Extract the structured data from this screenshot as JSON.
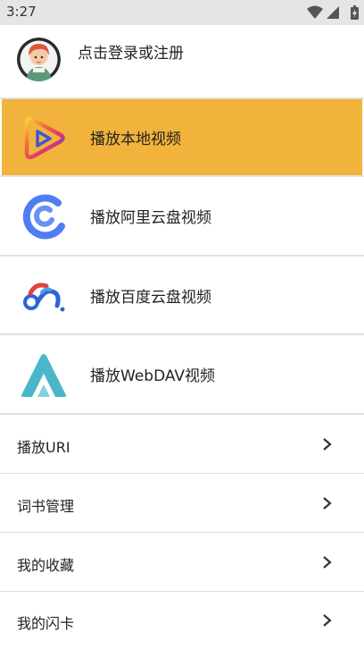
{
  "status_bar": {
    "time": "3:27"
  },
  "header": {
    "login_label": "点击登录或注册"
  },
  "tiles": [
    {
      "label": "播放本地视频",
      "icon": "play-triangle-icon"
    },
    {
      "label": "播放阿里云盘视频",
      "icon": "aliyun-drive-icon"
    },
    {
      "label": "播放百度云盘视频",
      "icon": "baidu-cloud-icon"
    },
    {
      "label": "播放WebDAV视频",
      "icon": "webdav-icon"
    }
  ],
  "rows": [
    {
      "label": "播放URI",
      "icon": "chevron-right-icon"
    },
    {
      "label": "词书管理",
      "icon": "chevron-right-icon"
    },
    {
      "label": "我的收藏",
      "icon": "chevron-right-icon"
    },
    {
      "label": "我的闪卡",
      "icon": "chevron-right-icon"
    }
  ],
  "colors": {
    "active_tile": "#f2b33c",
    "status_bar": "#e5e5e5",
    "aliyun_blue": "#4f7ef3",
    "baidu_blue": "#2d64d8",
    "baidu_red": "#e3403a",
    "webdav_teal": "#4ab7c9"
  }
}
